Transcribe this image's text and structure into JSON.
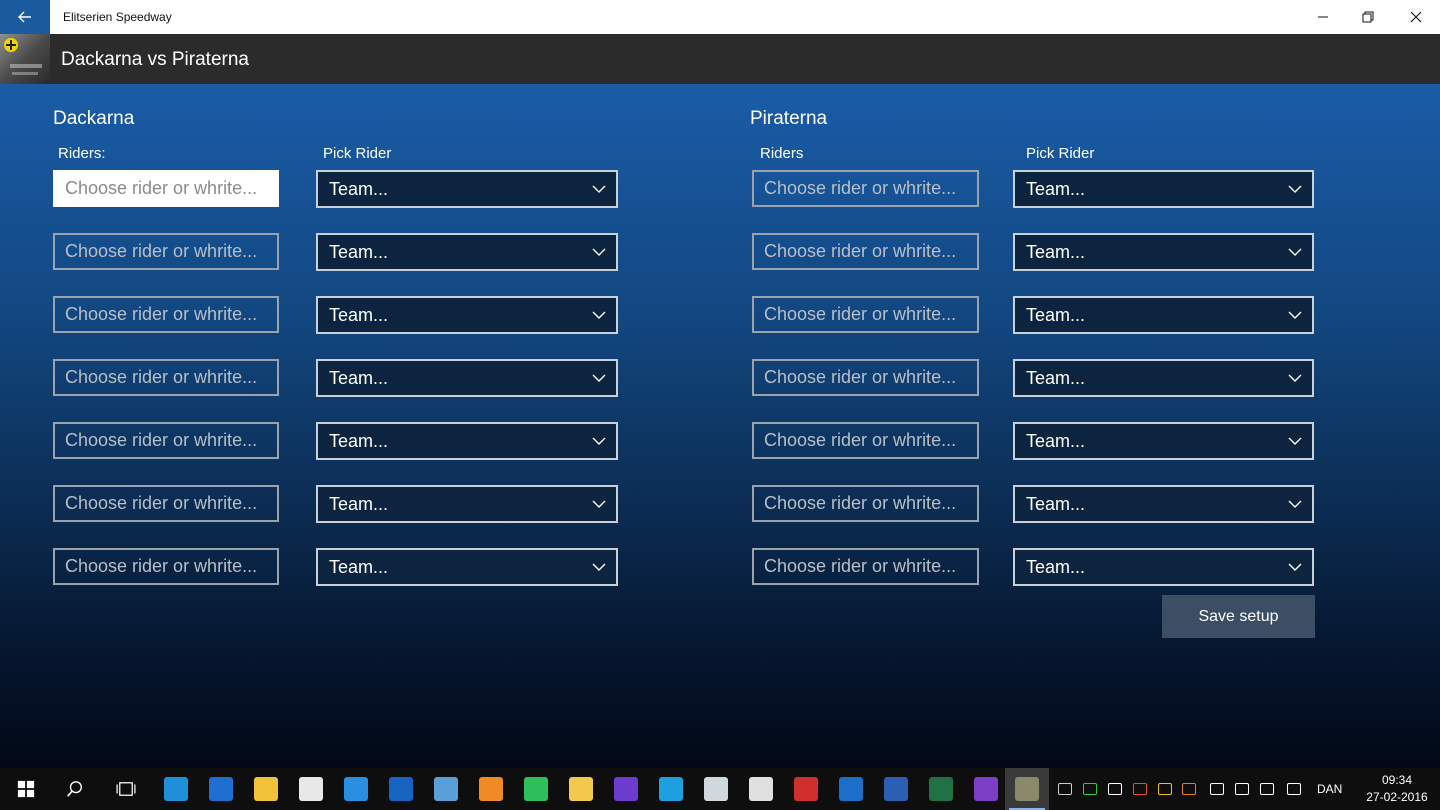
{
  "window": {
    "app_title": "Elitserien Speedway",
    "page_title": "Dackarna vs Piraterna"
  },
  "home": {
    "team_name": "Dackarna",
    "riders_label": "Riders:",
    "pick_label": "Pick Rider"
  },
  "away": {
    "team_name": "Piraterna",
    "riders_label": "Riders",
    "pick_label": "Pick Rider"
  },
  "rider_placeholder": "Choose rider or whrite...",
  "team_select_value": "Team...",
  "save_label": "Save setup",
  "taskbar": {
    "language": "DAN",
    "time": "09:34",
    "date": "27-02-2016"
  },
  "colors": {
    "accent": "#1a5b9e",
    "header": "#2b2b2b",
    "save_button": "#3b4e63"
  }
}
